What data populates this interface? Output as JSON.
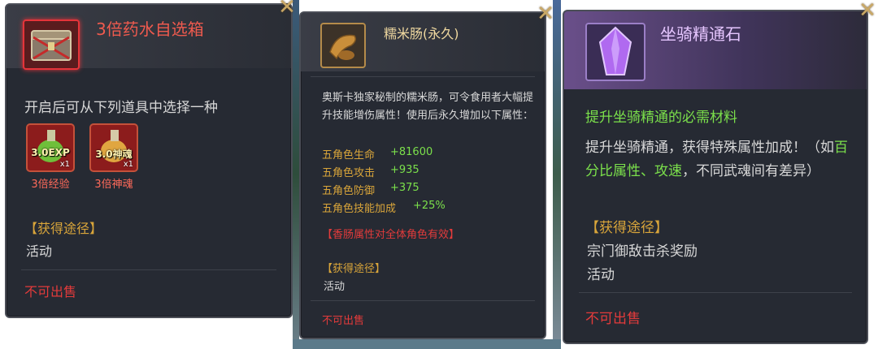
{
  "panel1": {
    "title": "3倍药水自选箱",
    "description": "开启后可从下列道具中选择一种",
    "items": [
      {
        "badge": "3.0EXP",
        "count": "x1",
        "name": "3倍经验"
      },
      {
        "badge": "3.0神魂",
        "count": "x1",
        "name": "3倍神魂"
      }
    ],
    "source_header": "【获得途径】",
    "source_list": [
      "活动"
    ],
    "sell_status": "不可出售"
  },
  "panel2": {
    "title": "糯米肠(永久)",
    "description": "奥斯卡独家秘制的糯米肠，可令食用者大幅提升技能增伤属性！使用后永久增加以下属性：",
    "stats": [
      {
        "label": "五角色生命",
        "value": "+81600"
      },
      {
        "label": "五角色攻击",
        "value": "+935"
      },
      {
        "label": "五角色防御",
        "value": "+375"
      },
      {
        "label": "五角色技能加成",
        "value": "+25%"
      }
    ],
    "note": "【香肠属性对全体角色有效】",
    "source_header": "【获得途径】",
    "source_list": [
      "活动"
    ],
    "sell_status": "不可出售"
  },
  "panel3": {
    "title": "坐骑精通石",
    "subtitle": "提升坐骑精通的必需材料",
    "desc_a": "提升坐骑精通，获得特殊属性加成！（如",
    "desc_highlight": "百分比属性、攻速",
    "desc_b": "，不同武魂间有差异）",
    "source_header": "【获得途径】",
    "source_list": [
      "宗门御敌击杀奖励",
      "活动"
    ],
    "sell_status": "不可出售"
  },
  "colors": {
    "panel_bg": "#262a33",
    "gold": "#d9a53a",
    "green": "#7be04b",
    "red": "#e33b3b",
    "title_red": "#ef5a4e",
    "title_purple": "#e6c6ff"
  }
}
